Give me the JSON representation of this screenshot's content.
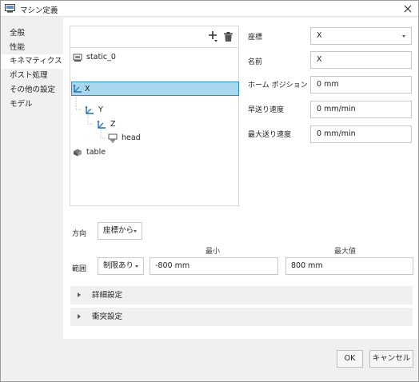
{
  "window": {
    "title": "マシン定義"
  },
  "sidebar": {
    "items": [
      {
        "label": "全般"
      },
      {
        "label": "性能"
      },
      {
        "label": "キネマティクス"
      },
      {
        "label": "ポスト処理"
      },
      {
        "label": "その他の設定"
      },
      {
        "label": "モデル"
      }
    ],
    "selected": "キネマティクス"
  },
  "tree": {
    "items": [
      {
        "label": "static_0",
        "icon": "static-component-icon"
      },
      {
        "label": "X",
        "icon": "linear-axis-icon",
        "selected": true
      },
      {
        "label": "Y",
        "icon": "linear-axis-icon"
      },
      {
        "label": "Z",
        "icon": "linear-axis-icon"
      },
      {
        "label": "head",
        "icon": "head-component-icon"
      },
      {
        "label": "table",
        "icon": "table-component-icon"
      }
    ]
  },
  "properties": {
    "coordinate_label": "座標",
    "coordinate_value": "X",
    "name_label": "名前",
    "name_value": "X",
    "home_label": "ホーム ポジション",
    "home_value": "0 mm",
    "rapid_label": "早送り速度",
    "rapid_value": "0 mm/min",
    "max_feed_label": "最大送り速度",
    "max_feed_value": "0 mm/min"
  },
  "direction": {
    "label": "方向",
    "value": "座標から"
  },
  "range": {
    "label": "範囲",
    "mode_value": "制限あり",
    "min_header": "最小",
    "max_header": "最大値",
    "min_value": "-800 mm",
    "max_value": "800 mm"
  },
  "sections": {
    "details": "詳細設定",
    "collision": "衝突設定"
  },
  "footer": {
    "ok": "OK",
    "cancel": "キャンセル"
  },
  "colors": {
    "selection": "#a9d8ee",
    "selection_border": "#2a8fc3",
    "axis_icon": "#1f6fb0"
  }
}
